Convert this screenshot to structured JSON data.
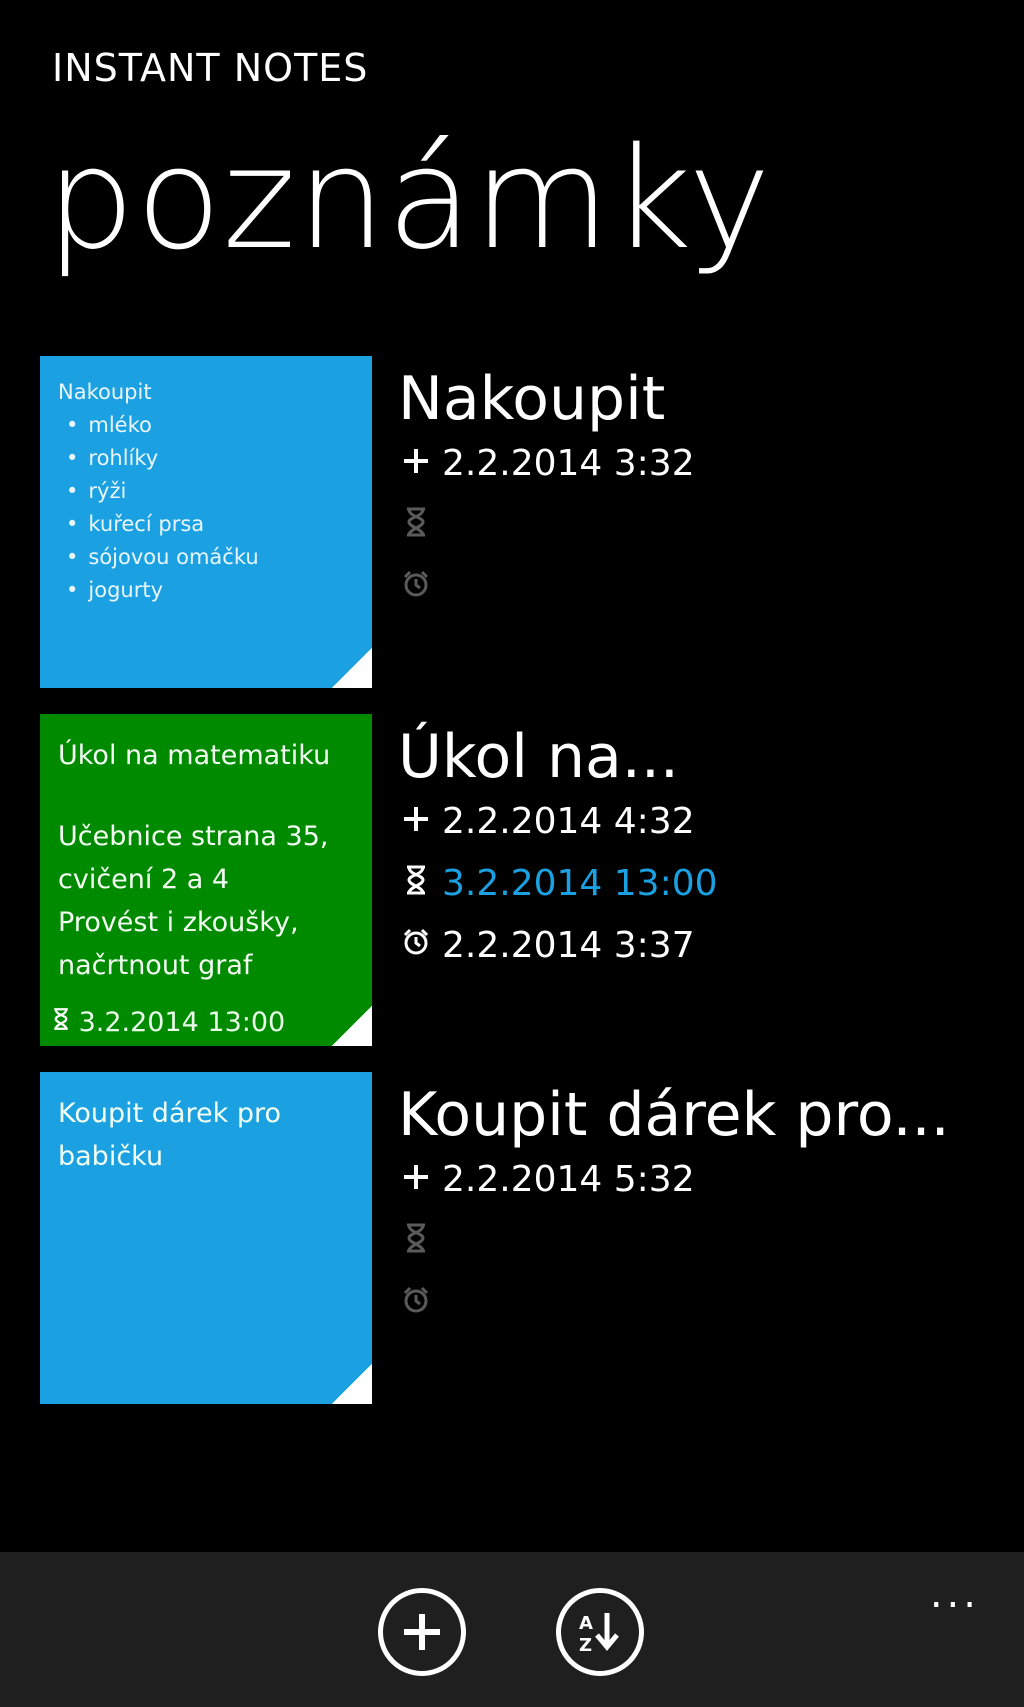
{
  "app": {
    "title": "INSTANT NOTES",
    "page_title": "poznámky"
  },
  "notes": [
    {
      "color": "#1ba1e2",
      "title": "Nakoupit",
      "card_heading": "Nakoupit",
      "card_items": [
        "mléko",
        "rohlíky",
        "rýži",
        "kuřecí prsa",
        "sójovou omáčku",
        "jogurty"
      ],
      "created": "2.2.2014 3:32",
      "deadline": "",
      "reminder": ""
    },
    {
      "color": "#008a00",
      "title": "Úkol na...",
      "card_lines": [
        "Úkol na matematiku",
        "",
        "Učebnice strana 35,",
        "cvičení 2 a 4",
        "Provést i zkoušky,",
        "načrtnout graf"
      ],
      "card_deadline": "3.2.2014 13:00",
      "created": "2.2.2014 4:32",
      "deadline": "3.2.2014 13:00",
      "reminder": "2.2.2014 3:37"
    },
    {
      "color": "#1ba1e2",
      "title": "Koupit dárek pro...",
      "card_lines": [
        "Koupit dárek pro",
        "babičku"
      ],
      "created": "2.2.2014 5:32",
      "deadline": "",
      "reminder": ""
    }
  ],
  "icons": {
    "created": "plus-icon",
    "deadline": "hourglass-icon",
    "reminder": "alarm-clock-icon",
    "add": "add-circle-icon",
    "sort": "sort-az-icon",
    "more": "more-dots-icon"
  },
  "app_bar": {
    "more_label": "..."
  },
  "colors": {
    "accent": "#1ba1e2",
    "green": "#008a00",
    "background": "#000000",
    "app_bar": "#1f1f1f"
  }
}
